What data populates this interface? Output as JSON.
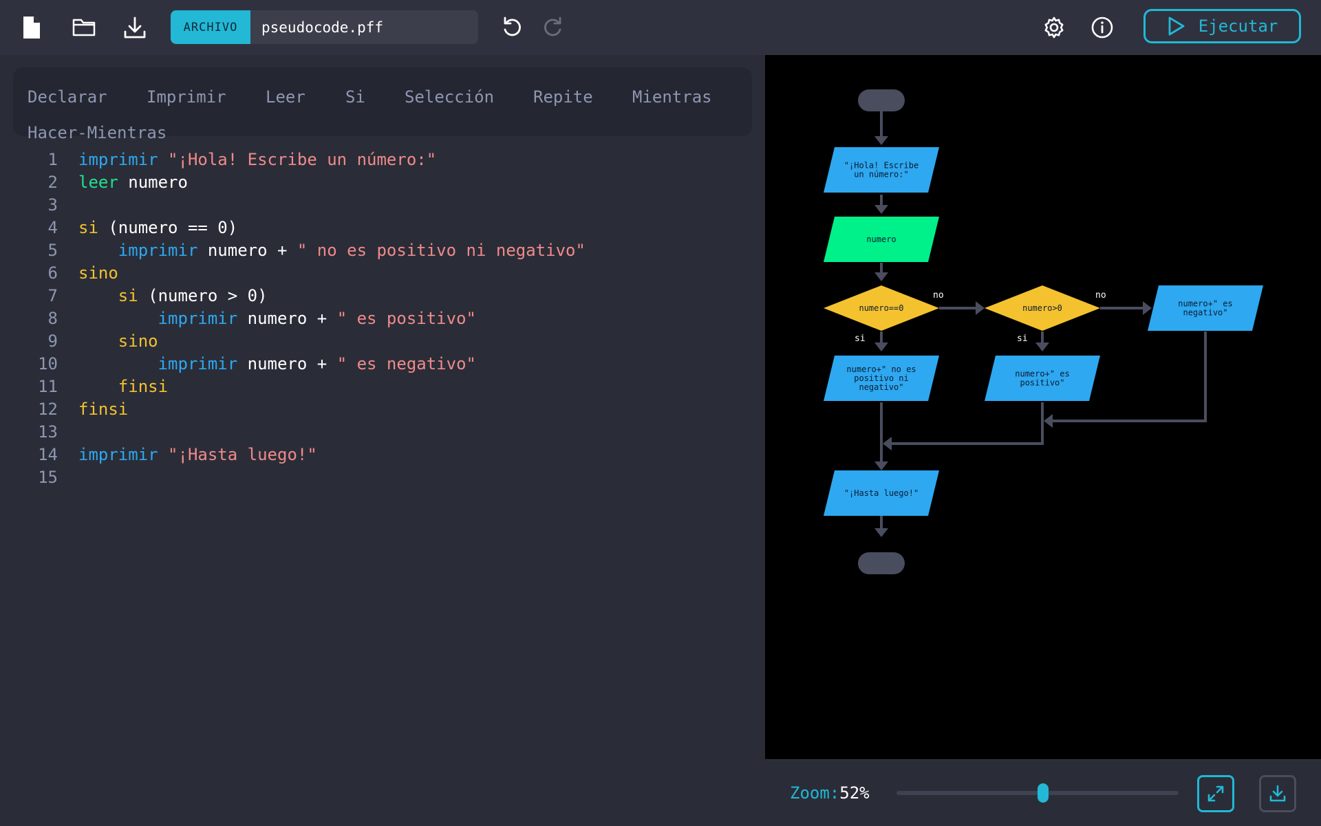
{
  "toolbar": {
    "file_tag": "ARCHIVO",
    "file_name": "pseudocode.pff",
    "run_label": "Ejecutar",
    "icons": [
      "new-file-icon",
      "open-folder-icon",
      "download-icon",
      "undo-icon",
      "redo-icon",
      "settings-icon",
      "info-icon",
      "play-icon"
    ]
  },
  "snippets": [
    "Declarar",
    "Imprimir",
    "Leer",
    "Si",
    "Selección",
    "Repite",
    "Mientras",
    "Hacer-Mientras"
  ],
  "code_lines": [
    {
      "n": "1",
      "indent": "",
      "tokens": [
        {
          "t": "imprimir",
          "c": "kw-imp"
        },
        {
          "t": " ",
          "c": "plain"
        },
        {
          "t": "\"¡Hola! Escribe un número:\"",
          "c": "str"
        }
      ]
    },
    {
      "n": "2",
      "indent": "",
      "tokens": [
        {
          "t": "leer",
          "c": "kw-leer"
        },
        {
          "t": " numero",
          "c": "plain"
        }
      ]
    },
    {
      "n": "3",
      "indent": "",
      "tokens": []
    },
    {
      "n": "4",
      "indent": "",
      "tokens": [
        {
          "t": "si",
          "c": "kw-ctrl"
        },
        {
          "t": " (numero == 0)",
          "c": "plain"
        }
      ]
    },
    {
      "n": "5",
      "indent": "    ",
      "tokens": [
        {
          "t": "imprimir",
          "c": "kw-imp"
        },
        {
          "t": " numero + ",
          "c": "plain"
        },
        {
          "t": "\" no es positivo ni negativo\"",
          "c": "str"
        }
      ]
    },
    {
      "n": "6",
      "indent": "",
      "tokens": [
        {
          "t": "sino",
          "c": "kw-ctrl"
        }
      ]
    },
    {
      "n": "7",
      "indent": "    ",
      "tokens": [
        {
          "t": "si",
          "c": "kw-ctrl"
        },
        {
          "t": " (numero > 0)",
          "c": "plain"
        }
      ]
    },
    {
      "n": "8",
      "indent": "        ",
      "tokens": [
        {
          "t": "imprimir",
          "c": "kw-imp"
        },
        {
          "t": " numero + ",
          "c": "plain"
        },
        {
          "t": "\" es positivo\"",
          "c": "str"
        }
      ]
    },
    {
      "n": "9",
      "indent": "    ",
      "tokens": [
        {
          "t": "sino",
          "c": "kw-ctrl"
        }
      ]
    },
    {
      "n": "10",
      "indent": "        ",
      "tokens": [
        {
          "t": "imprimir",
          "c": "kw-imp"
        },
        {
          "t": " numero + ",
          "c": "plain"
        },
        {
          "t": "\" es negativo\"",
          "c": "str"
        }
      ]
    },
    {
      "n": "11",
      "indent": "    ",
      "tokens": [
        {
          "t": "finsi",
          "c": "kw-ctrl"
        }
      ]
    },
    {
      "n": "12",
      "indent": "",
      "tokens": [
        {
          "t": "finsi",
          "c": "kw-ctrl"
        }
      ]
    },
    {
      "n": "13",
      "indent": "",
      "tokens": []
    },
    {
      "n": "14",
      "indent": "",
      "tokens": [
        {
          "t": "imprimir",
          "c": "kw-imp"
        },
        {
          "t": " ",
          "c": "plain"
        },
        {
          "t": "\"¡Hasta luego!\"",
          "c": "str"
        }
      ]
    },
    {
      "n": "15",
      "indent": "",
      "tokens": []
    }
  ],
  "flowchart": {
    "nodes": {
      "out1": [
        "\"¡Hola! Escribe",
        "un número:\""
      ],
      "in1": [
        "numero"
      ],
      "cond1": [
        "numero==0"
      ],
      "cond2": [
        "numero>0"
      ],
      "out_neg": [
        "numero+\" es",
        "negativo\""
      ],
      "out_zero": [
        "numero+\" no es",
        "positivo ni",
        "negativo\""
      ],
      "out_pos": [
        "numero+\" es",
        "positivo\""
      ],
      "out_end": [
        "\"¡Hasta luego!\""
      ]
    },
    "labels": {
      "no": "no",
      "si": "si"
    },
    "colors": {
      "output": "#2ea8f0",
      "input": "#00f08a",
      "condition": "#f4c22e",
      "terminal": "#4a4d5e",
      "line": "#4a4d5e"
    }
  },
  "zoom": {
    "label": "Zoom:",
    "value_text": "52%",
    "percent": 52
  },
  "colors": {
    "accent": "#22b8d6"
  }
}
